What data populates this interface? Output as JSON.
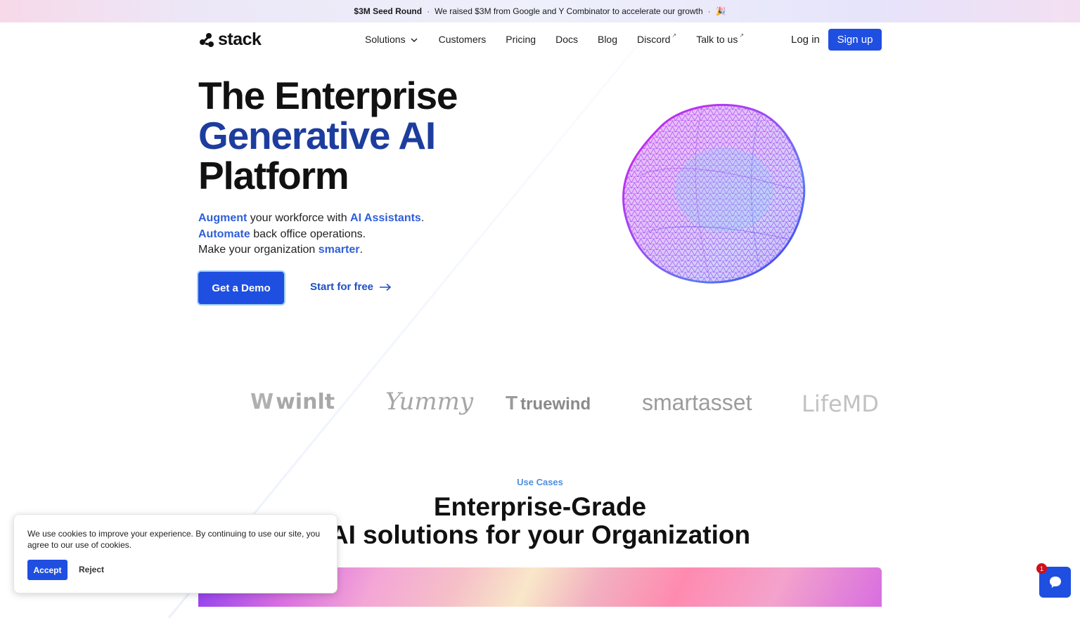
{
  "announcement": {
    "headline": "$3M Seed Round",
    "separator": "·",
    "message": "We raised $3M from Google and Y Combinator to accelerate our growth",
    "emoji": "🎉"
  },
  "nav": {
    "logo_text": "stack",
    "links": [
      {
        "label": "Solutions",
        "icon": "chevron-down-icon"
      },
      {
        "label": "Customers"
      },
      {
        "label": "Pricing"
      },
      {
        "label": "Docs"
      },
      {
        "label": "Blog"
      },
      {
        "label": "Discord",
        "external": true
      },
      {
        "label": "Talk to us",
        "external": true
      }
    ],
    "external_mark": "↗",
    "login_label": "Log in",
    "signup_label": "Sign up"
  },
  "hero": {
    "title_line1": "The Enterprise",
    "title_line2": "Generative AI",
    "title_line3": "Platform",
    "sub": {
      "l1_hl1": "Augment",
      "l1_mid": " your workforce with ",
      "l1_hl2": "AI Assistants",
      "l1_end": ".",
      "l2_hl": "Automate",
      "l2_rest": " back office operations.",
      "l3_start": "Make your organization ",
      "l3_hl": "smarter",
      "l3_end": "."
    },
    "demo_label": "Get a Demo",
    "free_label": "Start for free"
  },
  "customer_logos": [
    "winlt",
    "Yummy",
    "truewind",
    "smartasset",
    "LifeMD"
  ],
  "use_cases": {
    "eyebrow": "Use Cases",
    "title_line1": "Enterprise-Grade",
    "title_line2": "AI solutions for your Organization"
  },
  "cookie_banner": {
    "text": "We use cookies to improve your experience. By continuing to use our site, you agree to our use of cookies.",
    "accept_label": "Accept",
    "reject_label": "Reject"
  },
  "chat_widget": {
    "badge_count": "1",
    "icon": "chat-bubble-icon"
  },
  "colors": {
    "primary": "#1f4fe0",
    "hero_blue": "#1d3d9e",
    "highlight": "#2f5fd8"
  }
}
